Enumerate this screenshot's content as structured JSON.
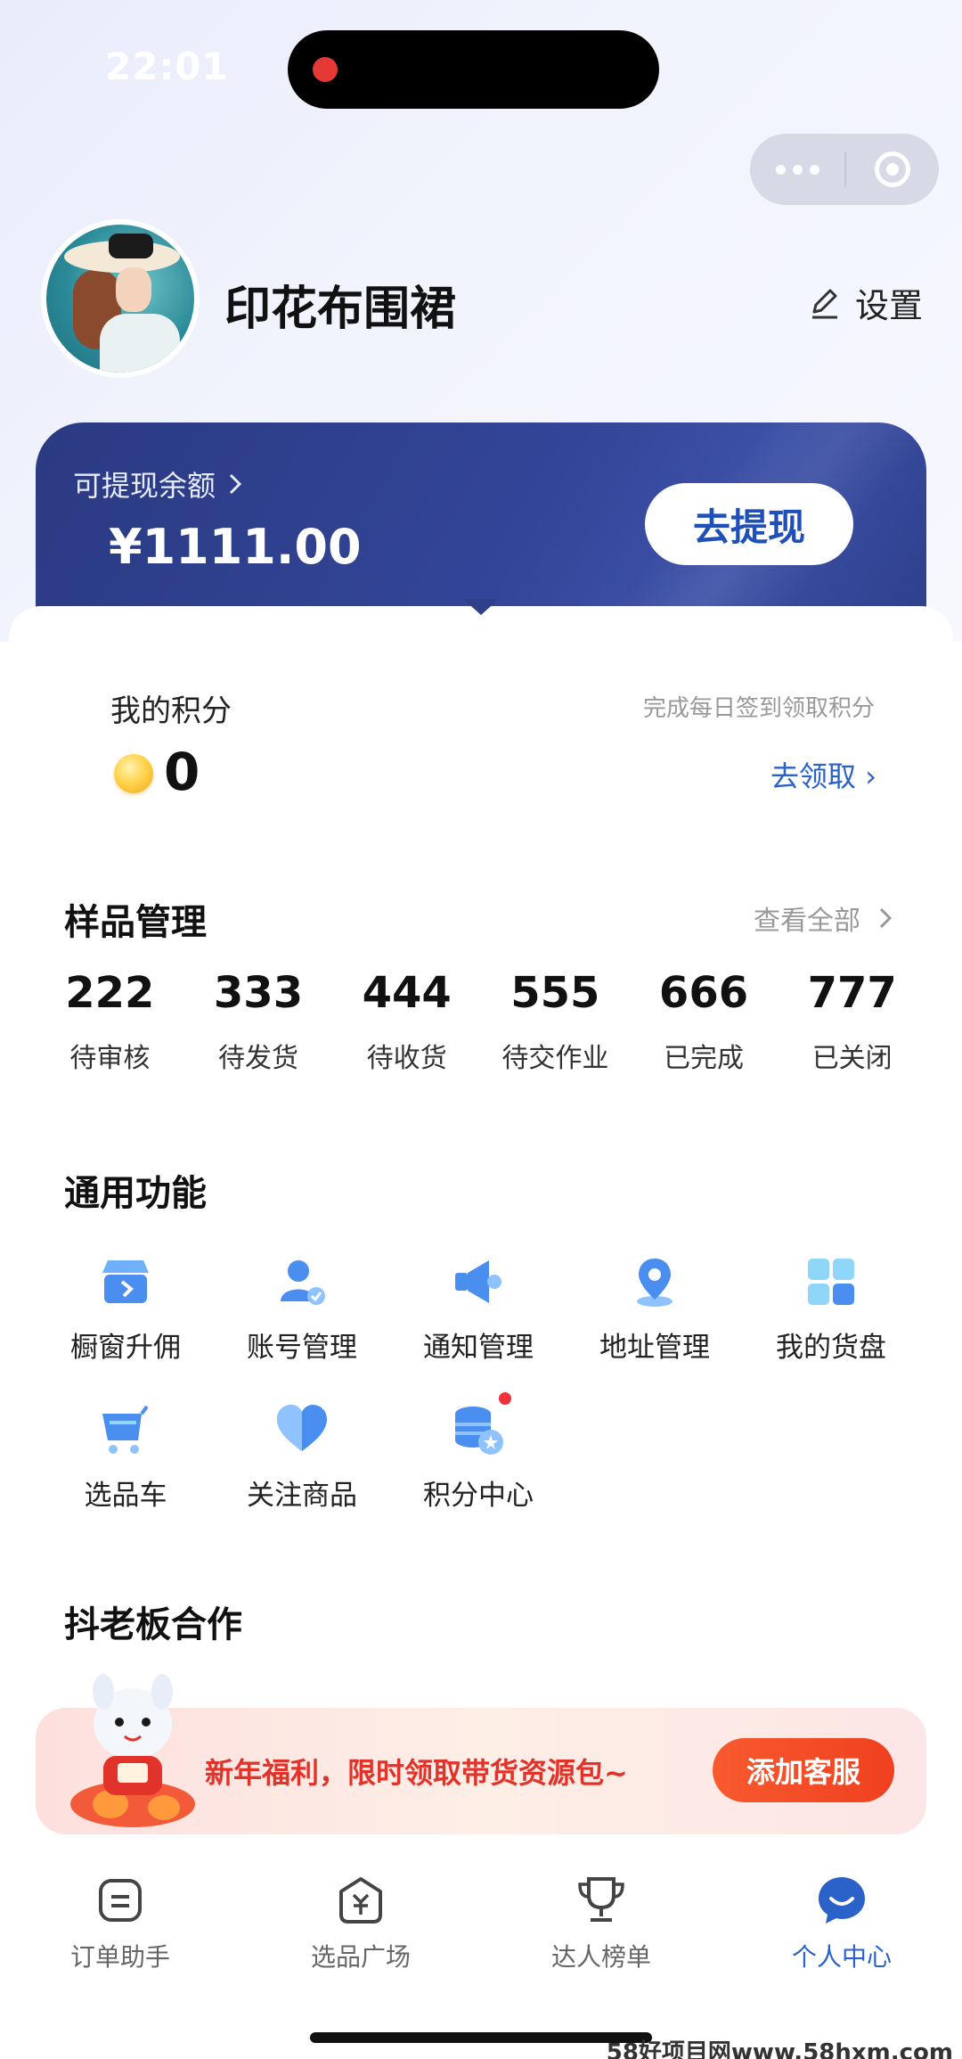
{
  "status_bar": {
    "time": "22:01"
  },
  "profile": {
    "name": "印花布围裙",
    "settings_label": "设置"
  },
  "wallet": {
    "label": "可提现余额",
    "amount": "¥1111.00",
    "withdraw_label": "去提现"
  },
  "points": {
    "title": "我的积分",
    "hint": "完成每日签到领取积分",
    "value": "0",
    "claim_label": "去领取"
  },
  "samples": {
    "title": "样品管理",
    "see_all": "查看全部",
    "stats": [
      {
        "value": "222",
        "label": "待审核"
      },
      {
        "value": "333",
        "label": "待发货"
      },
      {
        "value": "444",
        "label": "待收货"
      },
      {
        "value": "555",
        "label": "待交作业"
      },
      {
        "value": "666",
        "label": "已完成"
      },
      {
        "value": "777",
        "label": "已关闭"
      }
    ]
  },
  "functions": {
    "title": "通用功能",
    "items": [
      {
        "label": "橱窗升佣",
        "icon": "store-icon"
      },
      {
        "label": "账号管理",
        "icon": "user-check-icon"
      },
      {
        "label": "通知管理",
        "icon": "megaphone-icon"
      },
      {
        "label": "地址管理",
        "icon": "location-pin-icon"
      },
      {
        "label": "我的货盘",
        "icon": "grid-icon"
      },
      {
        "label": "选品车",
        "icon": "cart-icon"
      },
      {
        "label": "关注商品",
        "icon": "heart-icon"
      },
      {
        "label": "积分中心",
        "icon": "coins-star-icon"
      }
    ]
  },
  "boss": {
    "title": "抖老板合作"
  },
  "banner": {
    "text": "新年福利，限时领取带货资源包~",
    "button_label": "添加客服"
  },
  "tabbar": {
    "items": [
      {
        "label": "订单助手",
        "icon": "order-icon",
        "active": false
      },
      {
        "label": "选品广场",
        "icon": "yuan-bag-icon",
        "active": false
      },
      {
        "label": "达人榜单",
        "icon": "trophy-icon",
        "active": false
      },
      {
        "label": "个人中心",
        "icon": "smile-bubble-icon",
        "active": true
      }
    ]
  },
  "watermark": "58好项目网www.58hxm.com",
  "colors": {
    "brand_blue": "#2a62c9",
    "wallet_navy": "#2e3f8c",
    "banner_red": "#e2332b"
  }
}
